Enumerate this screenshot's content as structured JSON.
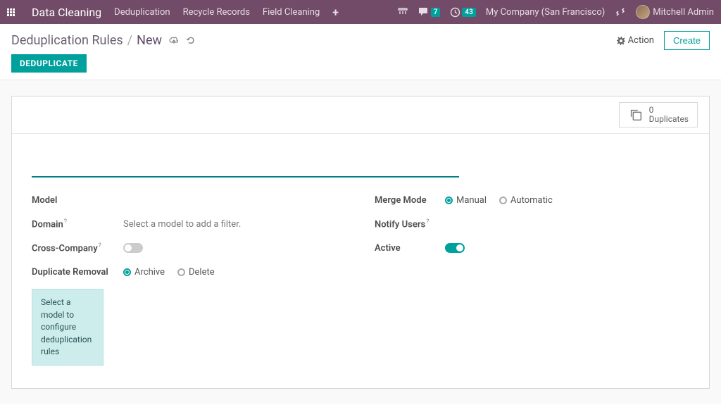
{
  "navbar": {
    "brand": "Data Cleaning",
    "links": [
      "Deduplication",
      "Recycle Records",
      "Field Cleaning"
    ],
    "messages_badge": "7",
    "activities_badge": "43",
    "company": "My Company (San Francisco)",
    "user": "Mitchell Admin"
  },
  "breadcrumb": {
    "root": "Deduplication Rules",
    "current": "New"
  },
  "cp": {
    "action_label": "Action",
    "create_label": "Create"
  },
  "status": {
    "deduplicate": "DEDUPLICATE"
  },
  "stat": {
    "count": "0",
    "label": "Duplicates"
  },
  "form": {
    "name_value": "",
    "model_label": "Model",
    "domain_label": "Domain",
    "domain_hint": "Select a model to add a filter.",
    "cross_company_label": "Cross-Company",
    "cross_company_on": false,
    "duplicate_removal_label": "Duplicate Removal",
    "removal_options": {
      "archive": "Archive",
      "delete": "Delete"
    },
    "removal_selected": "archive",
    "merge_mode_label": "Merge Mode",
    "merge_options": {
      "manual": "Manual",
      "automatic": "Automatic"
    },
    "merge_selected": "manual",
    "notify_users_label": "Notify Users",
    "active_label": "Active",
    "active_on": true,
    "config_hint": "Select a model to configure deduplication rules"
  }
}
